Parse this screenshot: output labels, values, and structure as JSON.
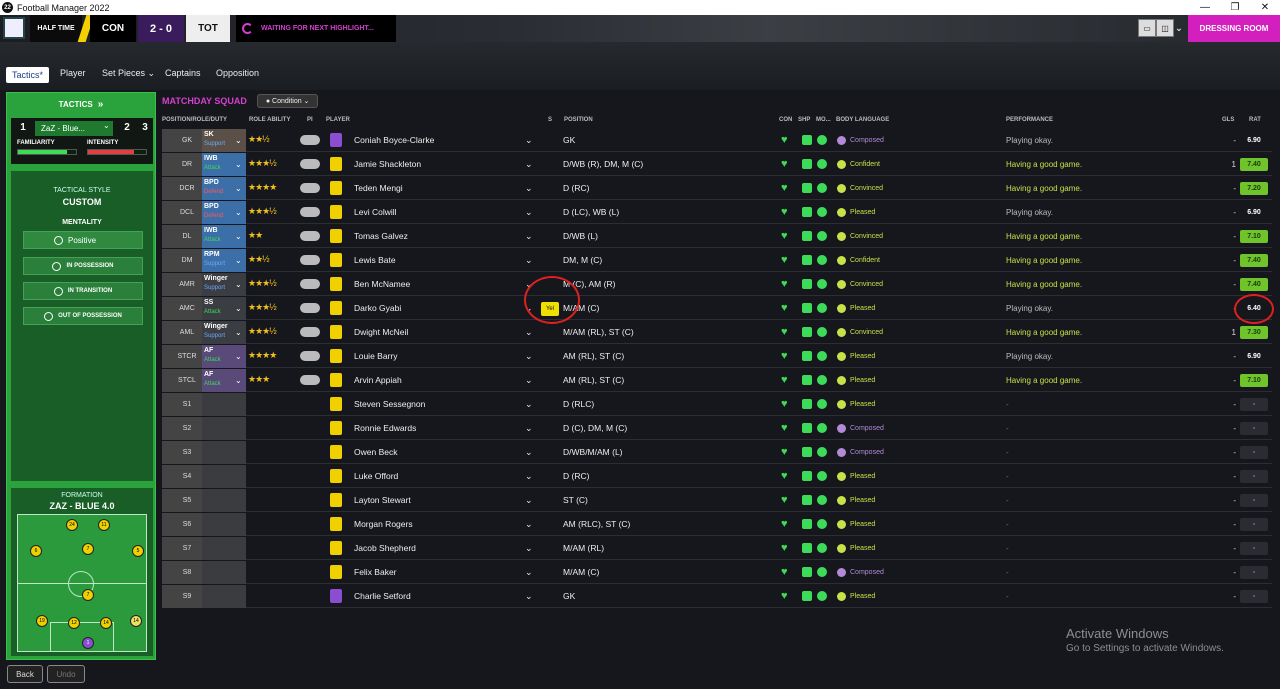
{
  "window": {
    "title": "Football Manager 2022",
    "app_icon": "22",
    "controls": [
      "—",
      "❐",
      "✕"
    ]
  },
  "match": {
    "period": "HALF TIME",
    "home": "CON",
    "score": "2 - 0",
    "away": "TOT",
    "status": "WAITING FOR NEXT HIGHLIGHT...",
    "dressing_room": "DRESSING ROOM"
  },
  "tabs": {
    "tactics": "Tactics*",
    "player": "Player",
    "set_pieces": "Set Pieces ⌄",
    "captains": "Captains",
    "opposition": "Opposition"
  },
  "left": {
    "header": "TACTICS",
    "tactic_num_left": "1",
    "tactic_name": "ZaZ - Blue...",
    "tactic_num_2": "2",
    "tactic_num_3": "3",
    "familiarity_label": "FAMILIARITY",
    "intensity_label": "INTENSITY",
    "style_label": "TACTICAL STYLE",
    "style_value": "CUSTOM",
    "mentality_label": "MENTALITY",
    "mentality_value": "Positive",
    "in_possession": "IN POSSESSION",
    "in_transition": "IN TRANSITION",
    "out_of_possession": "OUT OF POSSESSION",
    "formation_label": "FORMATION",
    "formation_value": "ZAZ - BLUE 4.0",
    "pitch_numbers": [
      "24",
      "11",
      "6",
      "7",
      "5",
      "7",
      "19",
      "12",
      "14",
      "1"
    ],
    "back": "Back",
    "undo": "Undo"
  },
  "squad": {
    "title": "MATCHDAY SQUAD",
    "condition": "Condition",
    "headers": {
      "posrole": "POSITION/ROLE/DUTY",
      "ability": "ROLE ABILITY",
      "pi": "PI",
      "player": "PLAYER",
      "s": "S",
      "position": "POSITION",
      "con": "CON",
      "shp": "SHP",
      "mo": "MO...",
      "body": "BODY LANGUAGE",
      "performance": "PERFORMANCE",
      "gls": "GLS",
      "rat": "RAT"
    },
    "rows": [
      {
        "pos": "GK",
        "role": "SK",
        "duty": "Support",
        "stars": "★★½",
        "name": "Coniah Boyce-Clarke",
        "position": "GK",
        "body": "Composed",
        "perf": "Playing okay.",
        "gls": "-",
        "rat": "6.90"
      },
      {
        "pos": "DR",
        "role": "IWB",
        "duty": "Attack",
        "stars": "★★★½",
        "name": "Jamie Shackleton",
        "position": "D/WB (R), DM, M (C)",
        "body": "Confident",
        "perf": "Having a good game.",
        "gls": "1",
        "rat": "7.40"
      },
      {
        "pos": "DCR",
        "role": "BPD",
        "duty": "Defend",
        "stars": "★★★★",
        "name": "Teden Mengi",
        "position": "D (RC)",
        "body": "Convinced",
        "perf": "Having a good game.",
        "gls": "-",
        "rat": "7.20"
      },
      {
        "pos": "DCL",
        "role": "BPD",
        "duty": "Defend",
        "stars": "★★★½",
        "name": "Levi Colwill",
        "position": "D (LC), WB (L)",
        "body": "Pleased",
        "perf": "Playing okay.",
        "gls": "-",
        "rat": "6.90"
      },
      {
        "pos": "DL",
        "role": "IWB",
        "duty": "Attack",
        "stars": "★★",
        "name": "Tomas Galvez",
        "position": "D/WB (L)",
        "body": "Convinced",
        "perf": "Having a good game.",
        "gls": "-",
        "rat": "7.10"
      },
      {
        "pos": "DM",
        "role": "RPM",
        "duty": "Support",
        "stars": "★★½",
        "name": "Lewis Bate",
        "position": "DM, M (C)",
        "body": "Confident",
        "perf": "Having a good game.",
        "gls": "-",
        "rat": "7.40"
      },
      {
        "pos": "AMR",
        "role": "Winger",
        "duty": "Support",
        "stars": "★★★½",
        "name": "Ben McNamee",
        "position": "M (C), AM (R)",
        "body": "Convinced",
        "perf": "Having a good game.",
        "gls": "-",
        "rat": "7.40"
      },
      {
        "pos": "AMC",
        "role": "SS",
        "duty": "Attack",
        "stars": "★★★½",
        "name": "Darko Gyabi",
        "position": "M/AM (C)",
        "body": "Pleased",
        "perf": "Playing okay.",
        "gls": "-",
        "rat": "6.40"
      },
      {
        "pos": "AML",
        "role": "Winger",
        "duty": "Support",
        "stars": "★★★½",
        "name": "Dwight McNeil",
        "position": "M/AM (RL), ST (C)",
        "body": "Convinced",
        "perf": "Having a good game.",
        "gls": "1",
        "rat": "7.30"
      },
      {
        "pos": "STCR",
        "role": "AF",
        "duty": "Attack",
        "stars": "★★★★",
        "name": "Louie Barry",
        "position": "AM (RL), ST (C)",
        "body": "Pleased",
        "perf": "Playing okay.",
        "gls": "-",
        "rat": "6.90"
      },
      {
        "pos": "STCL",
        "role": "AF",
        "duty": "Attack",
        "stars": "★★★",
        "name": "Arvin Appiah",
        "position": "AM (RL), ST (C)",
        "body": "Pleased",
        "perf": "Having a good game.",
        "gls": "-",
        "rat": "7.10"
      },
      {
        "pos": "S1",
        "role": "",
        "duty": "",
        "stars": "",
        "name": "Steven Sessegnon",
        "position": "D (RLC)",
        "body": "Pleased",
        "perf": "-",
        "gls": "-",
        "rat": "-"
      },
      {
        "pos": "S2",
        "role": "",
        "duty": "",
        "stars": "",
        "name": "Ronnie Edwards",
        "position": "D (C), DM, M (C)",
        "body": "Composed",
        "perf": "-",
        "gls": "-",
        "rat": "-"
      },
      {
        "pos": "S3",
        "role": "",
        "duty": "",
        "stars": "",
        "name": "Owen Beck",
        "position": "D/WB/M/AM (L)",
        "body": "Composed",
        "perf": "-",
        "gls": "-",
        "rat": "-"
      },
      {
        "pos": "S4",
        "role": "",
        "duty": "",
        "stars": "",
        "name": "Luke Offord",
        "position": "D (RC)",
        "body": "Pleased",
        "perf": "-",
        "gls": "-",
        "rat": "-"
      },
      {
        "pos": "S5",
        "role": "",
        "duty": "",
        "stars": "",
        "name": "Layton Stewart",
        "position": "ST (C)",
        "body": "Pleased",
        "perf": "-",
        "gls": "-",
        "rat": "-"
      },
      {
        "pos": "S6",
        "role": "",
        "duty": "",
        "stars": "",
        "name": "Morgan Rogers",
        "position": "AM (RLC), ST (C)",
        "body": "Pleased",
        "perf": "-",
        "gls": "-",
        "rat": "-"
      },
      {
        "pos": "S7",
        "role": "",
        "duty": "",
        "stars": "",
        "name": "Jacob Shepherd",
        "position": "M/AM (RL)",
        "body": "Pleased",
        "perf": "-",
        "gls": "-",
        "rat": "-"
      },
      {
        "pos": "S8",
        "role": "",
        "duty": "",
        "stars": "",
        "name": "Felix Baker",
        "position": "M/AM (C)",
        "body": "Composed",
        "perf": "-",
        "gls": "-",
        "rat": "-"
      },
      {
        "pos": "S9",
        "role": "",
        "duty": "",
        "stars": "",
        "name": "Charlie Setford",
        "position": "GK",
        "body": "Pleased",
        "perf": "-",
        "gls": "-",
        "rat": "-"
      }
    ],
    "tooltip": "Yel"
  },
  "watermark": {
    "line1": "Activate Windows",
    "line2": "Go to Settings to activate Windows."
  },
  "colors": {
    "accent": "#d21fbd",
    "panel_green": "#2aa33c",
    "good": "#3edb59",
    "rating_good": "#6ec42a"
  }
}
